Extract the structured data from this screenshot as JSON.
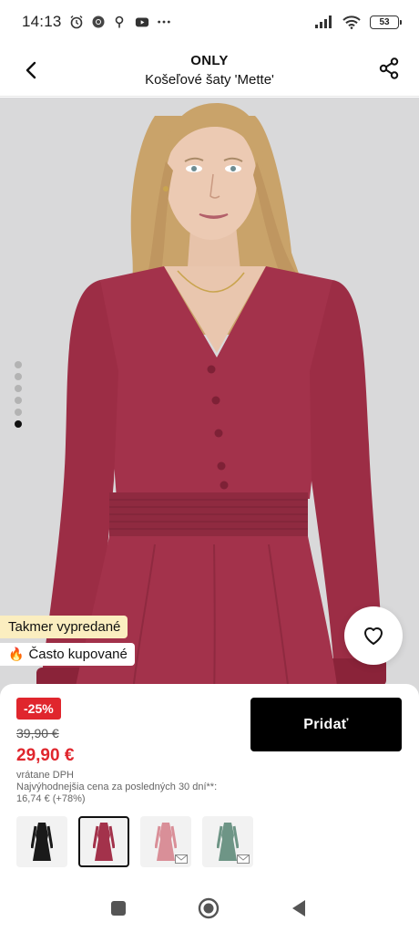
{
  "status_bar": {
    "time": "14:13",
    "left_icons": [
      "alarm-icon",
      "chrome-icon",
      "location-icon",
      "youtube-icon",
      "more-dots-icon"
    ],
    "right_icons": [
      "signal-icon",
      "wifi-icon",
      "battery-icon"
    ],
    "battery": "53"
  },
  "header": {
    "brand": "ONLY",
    "product_name": "Košeľové šaty 'Mette'",
    "back_icon": "back-arrow-icon",
    "share_icon": "share-icon"
  },
  "gallery": {
    "pages": 6,
    "active_page": 6,
    "colors": {
      "background": "#d9d9da",
      "dress": "#a3324b"
    }
  },
  "badges": {
    "sold_out": "Takmer vypredané",
    "popular": "Často kupované",
    "popular_icon": "fire-icon"
  },
  "wishlist_icon": "heart-icon",
  "pricing": {
    "discount": "-25%",
    "old_price": "39,90 €",
    "new_price": "29,90 €",
    "vat_note": "vrátane DPH",
    "lowest_price_note_line1": "Najvýhodnejšia cena za posledných 30 dní**:",
    "lowest_price_note_line2": "16,74 € (+78%)",
    "accent_color": "#e0262d"
  },
  "add_button": {
    "label": "Pridať"
  },
  "color_variants": [
    {
      "name": "black",
      "color": "#1a1a1a",
      "selected": false,
      "notify": false
    },
    {
      "name": "burgundy",
      "color": "#a3324b",
      "selected": true,
      "notify": false
    },
    {
      "name": "pink",
      "color": "#d98f98",
      "selected": false,
      "notify": true
    },
    {
      "name": "sage",
      "color": "#6e9586",
      "selected": false,
      "notify": true
    }
  ],
  "nav_bar": {
    "items": [
      "recent-apps-icon",
      "home-icon",
      "back-icon"
    ]
  }
}
